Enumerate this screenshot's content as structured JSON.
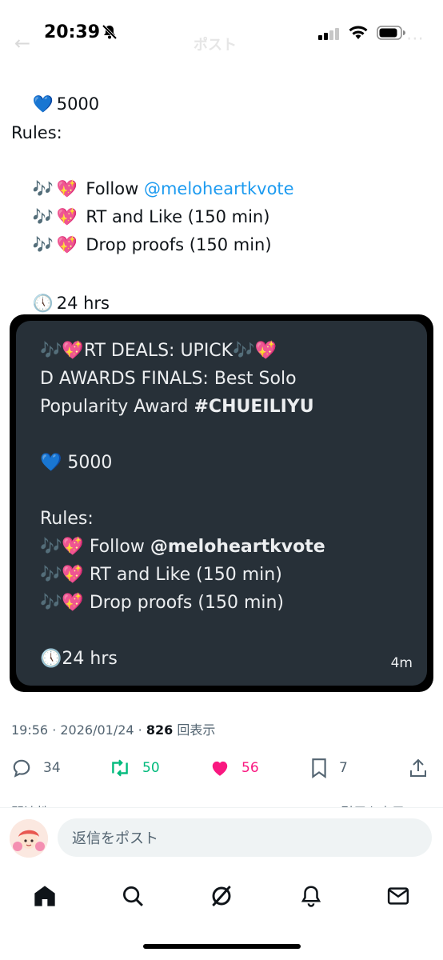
{
  "status": {
    "time": "20:39"
  },
  "ghost_header": {
    "back": "←",
    "title": "ポスト",
    "more": "⋯"
  },
  "tweet": {
    "emoji_heart": "💙",
    "emoji_notes": "🎶",
    "emoji_sparkle_heart": "💖",
    "emoji_clock": "🕔",
    "count": "5000",
    "rules_label": "Rules:",
    "follow_label": "Follow",
    "mention": "@meloheartkvote",
    "rule2": "RT and Like (150 min)",
    "rule3": "Drop proofs (150 min)",
    "duration": "24 hrs"
  },
  "quote": {
    "line1": "RT DEALS: UPICK",
    "line2": "D AWARDS FINALS: Best Solo",
    "line3_prefix": "Popularity Award ",
    "hashtag": "#CHUEILIYU",
    "count": "5000",
    "rules_label": "Rules:",
    "follow_label": "Follow ",
    "mention": "@meloheartkvote",
    "rule2": "RT and Like (150 min)",
    "rule3": "Drop proofs (150 min)",
    "duration": "24 hrs",
    "age": "4m"
  },
  "meta": {
    "datetime": "19:56 · 2026/01/24 · ",
    "views_count": "826",
    "views_label": " 回表示"
  },
  "actions": {
    "replies": "34",
    "retweets": "50",
    "likes": "56",
    "bookmarks": "7"
  },
  "cutoff": {
    "left": "関連性",
    "right": "引用を表示"
  },
  "reply": {
    "placeholder": "返信をポスト"
  },
  "colors": {
    "mention": "#1d9bf0",
    "retweet": "#00ba7c",
    "like": "#f91880",
    "quote_bg": "#273038"
  }
}
